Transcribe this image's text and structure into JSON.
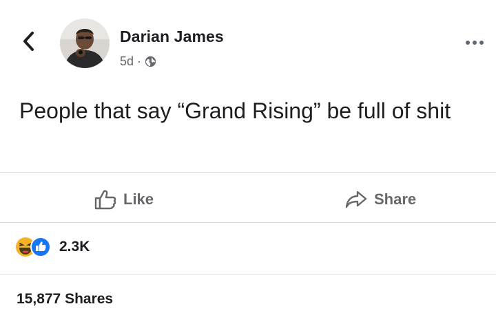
{
  "header": {
    "back_icon": "chevron-left-icon",
    "author_name": "Darian James",
    "time_ago": "5d",
    "separator": "·",
    "privacy_icon": "globe-icon",
    "more_icon": "more-horizontal-icon"
  },
  "post": {
    "text": "People that say “Grand Rising” be full of shit"
  },
  "actions": {
    "like_label": "Like",
    "like_icon": "thumbs-up-outline-icon",
    "share_label": "Share",
    "share_icon": "share-arrow-icon"
  },
  "engagement": {
    "reaction_icons": [
      "haha-emoji-icon",
      "like-reaction-icon"
    ],
    "reaction_count": "2.3K",
    "shares_text": "15,877 Shares"
  },
  "colors": {
    "text_primary": "#1c1e21",
    "text_secondary": "#65676b",
    "divider": "#dadde1",
    "like_blue": "#1877f2",
    "haha_yellow": "#f7b125"
  }
}
